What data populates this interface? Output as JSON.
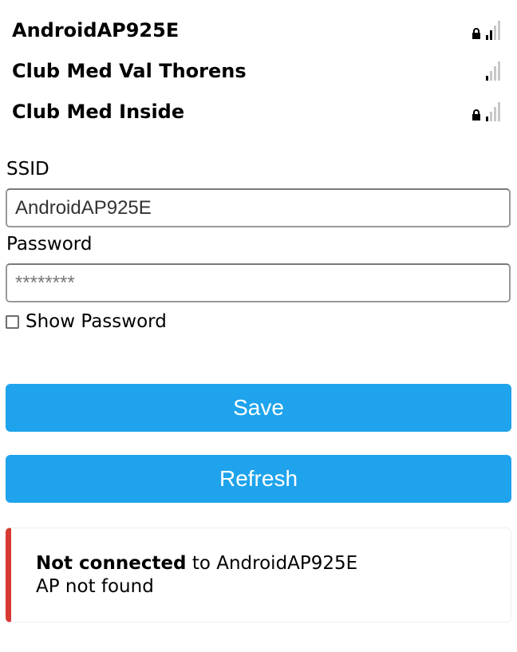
{
  "networks": [
    {
      "name": "AndroidAP925E",
      "secured": true,
      "signal_bars": 2,
      "signal_icon": "signal-icon",
      "lock_icon": "lock-icon"
    },
    {
      "name": "Club Med Val Thorens",
      "secured": false,
      "signal_bars": 1,
      "signal_icon": "signal-icon"
    },
    {
      "name": "Club Med Inside",
      "secured": true,
      "signal_bars": 1,
      "signal_icon": "signal-icon",
      "lock_icon": "lock-icon"
    }
  ],
  "form": {
    "ssid_label": "SSID",
    "ssid_value": "AndroidAP925E",
    "password_label": "Password",
    "password_placeholder": "********",
    "show_password_label": "Show Password",
    "show_password_checked": false
  },
  "buttons": {
    "save_label": "Save",
    "refresh_label": "Refresh"
  },
  "status": {
    "state": "Not connected",
    "connector": " to ",
    "ssid": "AndroidAP925E",
    "detail": "AP not found"
  },
  "colors": {
    "accent": "#1fa3ec",
    "error": "#d63a33"
  }
}
